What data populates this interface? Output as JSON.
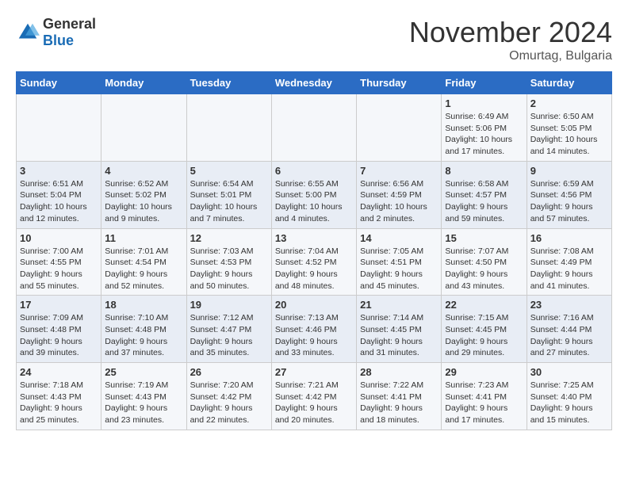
{
  "logo": {
    "text_general": "General",
    "text_blue": "Blue"
  },
  "header": {
    "month": "November 2024",
    "location": "Omurtag, Bulgaria"
  },
  "weekdays": [
    "Sunday",
    "Monday",
    "Tuesday",
    "Wednesday",
    "Thursday",
    "Friday",
    "Saturday"
  ],
  "weeks": [
    [
      {
        "day": "",
        "detail": ""
      },
      {
        "day": "",
        "detail": ""
      },
      {
        "day": "",
        "detail": ""
      },
      {
        "day": "",
        "detail": ""
      },
      {
        "day": "",
        "detail": ""
      },
      {
        "day": "1",
        "detail": "Sunrise: 6:49 AM\nSunset: 5:06 PM\nDaylight: 10 hours and 17 minutes."
      },
      {
        "day": "2",
        "detail": "Sunrise: 6:50 AM\nSunset: 5:05 PM\nDaylight: 10 hours and 14 minutes."
      }
    ],
    [
      {
        "day": "3",
        "detail": "Sunrise: 6:51 AM\nSunset: 5:04 PM\nDaylight: 10 hours and 12 minutes."
      },
      {
        "day": "4",
        "detail": "Sunrise: 6:52 AM\nSunset: 5:02 PM\nDaylight: 10 hours and 9 minutes."
      },
      {
        "day": "5",
        "detail": "Sunrise: 6:54 AM\nSunset: 5:01 PM\nDaylight: 10 hours and 7 minutes."
      },
      {
        "day": "6",
        "detail": "Sunrise: 6:55 AM\nSunset: 5:00 PM\nDaylight: 10 hours and 4 minutes."
      },
      {
        "day": "7",
        "detail": "Sunrise: 6:56 AM\nSunset: 4:59 PM\nDaylight: 10 hours and 2 minutes."
      },
      {
        "day": "8",
        "detail": "Sunrise: 6:58 AM\nSunset: 4:57 PM\nDaylight: 9 hours and 59 minutes."
      },
      {
        "day": "9",
        "detail": "Sunrise: 6:59 AM\nSunset: 4:56 PM\nDaylight: 9 hours and 57 minutes."
      }
    ],
    [
      {
        "day": "10",
        "detail": "Sunrise: 7:00 AM\nSunset: 4:55 PM\nDaylight: 9 hours and 55 minutes."
      },
      {
        "day": "11",
        "detail": "Sunrise: 7:01 AM\nSunset: 4:54 PM\nDaylight: 9 hours and 52 minutes."
      },
      {
        "day": "12",
        "detail": "Sunrise: 7:03 AM\nSunset: 4:53 PM\nDaylight: 9 hours and 50 minutes."
      },
      {
        "day": "13",
        "detail": "Sunrise: 7:04 AM\nSunset: 4:52 PM\nDaylight: 9 hours and 48 minutes."
      },
      {
        "day": "14",
        "detail": "Sunrise: 7:05 AM\nSunset: 4:51 PM\nDaylight: 9 hours and 45 minutes."
      },
      {
        "day": "15",
        "detail": "Sunrise: 7:07 AM\nSunset: 4:50 PM\nDaylight: 9 hours and 43 minutes."
      },
      {
        "day": "16",
        "detail": "Sunrise: 7:08 AM\nSunset: 4:49 PM\nDaylight: 9 hours and 41 minutes."
      }
    ],
    [
      {
        "day": "17",
        "detail": "Sunrise: 7:09 AM\nSunset: 4:48 PM\nDaylight: 9 hours and 39 minutes."
      },
      {
        "day": "18",
        "detail": "Sunrise: 7:10 AM\nSunset: 4:48 PM\nDaylight: 9 hours and 37 minutes."
      },
      {
        "day": "19",
        "detail": "Sunrise: 7:12 AM\nSunset: 4:47 PM\nDaylight: 9 hours and 35 minutes."
      },
      {
        "day": "20",
        "detail": "Sunrise: 7:13 AM\nSunset: 4:46 PM\nDaylight: 9 hours and 33 minutes."
      },
      {
        "day": "21",
        "detail": "Sunrise: 7:14 AM\nSunset: 4:45 PM\nDaylight: 9 hours and 31 minutes."
      },
      {
        "day": "22",
        "detail": "Sunrise: 7:15 AM\nSunset: 4:45 PM\nDaylight: 9 hours and 29 minutes."
      },
      {
        "day": "23",
        "detail": "Sunrise: 7:16 AM\nSunset: 4:44 PM\nDaylight: 9 hours and 27 minutes."
      }
    ],
    [
      {
        "day": "24",
        "detail": "Sunrise: 7:18 AM\nSunset: 4:43 PM\nDaylight: 9 hours and 25 minutes."
      },
      {
        "day": "25",
        "detail": "Sunrise: 7:19 AM\nSunset: 4:43 PM\nDaylight: 9 hours and 23 minutes."
      },
      {
        "day": "26",
        "detail": "Sunrise: 7:20 AM\nSunset: 4:42 PM\nDaylight: 9 hours and 22 minutes."
      },
      {
        "day": "27",
        "detail": "Sunrise: 7:21 AM\nSunset: 4:42 PM\nDaylight: 9 hours and 20 minutes."
      },
      {
        "day": "28",
        "detail": "Sunrise: 7:22 AM\nSunset: 4:41 PM\nDaylight: 9 hours and 18 minutes."
      },
      {
        "day": "29",
        "detail": "Sunrise: 7:23 AM\nSunset: 4:41 PM\nDaylight: 9 hours and 17 minutes."
      },
      {
        "day": "30",
        "detail": "Sunrise: 7:25 AM\nSunset: 4:40 PM\nDaylight: 9 hours and 15 minutes."
      }
    ]
  ]
}
